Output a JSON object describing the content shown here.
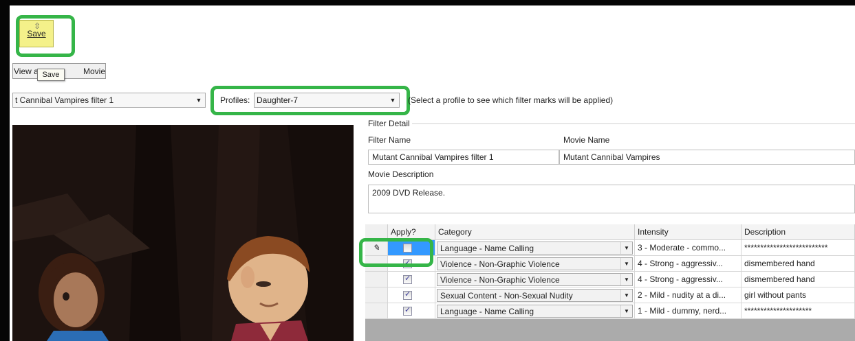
{
  "toolbar": {
    "save_label": "Save",
    "save_tooltip": "Save",
    "view_label_left": "View a",
    "view_label_right": "Movie"
  },
  "filter_bar": {
    "filter_select_value": "t Cannibal Vampires filter 1",
    "profiles_label": "Profiles:",
    "profile_select_value": "Daughter-7",
    "hint_text": "(Select a profile to see which filter marks will be applied)"
  },
  "filter_detail": {
    "group_title": "Filter Detail",
    "filter_name_label": "Filter Name",
    "filter_name_value": "Mutant Cannibal Vampires filter 1",
    "movie_name_label": "Movie Name",
    "movie_name_value": "Mutant Cannibal Vampires",
    "movie_description_label": "Movie Description",
    "movie_description_value": "2009 DVD Release."
  },
  "grid": {
    "columns": [
      "Apply?",
      "Category",
      "Intensity",
      "Description"
    ],
    "rows": [
      {
        "marker": "✎",
        "apply": false,
        "category": "Language - Name Calling",
        "intensity": "3 - Moderate - commo...",
        "description": "**************************"
      },
      {
        "marker": "",
        "apply": true,
        "category": "Violence - Non-Graphic Violence",
        "intensity": "4 - Strong - aggressiv...",
        "description": "dismembered hand"
      },
      {
        "marker": "",
        "apply": true,
        "category": "Violence - Non-Graphic Violence",
        "intensity": "4 - Strong - aggressiv...",
        "description": "dismembered hand"
      },
      {
        "marker": "",
        "apply": true,
        "category": "Sexual Content - Non-Sexual Nudity",
        "intensity": "2 - Mild - nudity at a di...",
        "description": "girl without pants"
      },
      {
        "marker": "",
        "apply": true,
        "category": "Language - Name Calling",
        "intensity": "1 - Mild - dummy, nerd...",
        "description": "*********************"
      }
    ]
  },
  "colors": {
    "highlight": "#35b548",
    "save_button": "#f4f18a",
    "selection": "#3399ff"
  }
}
